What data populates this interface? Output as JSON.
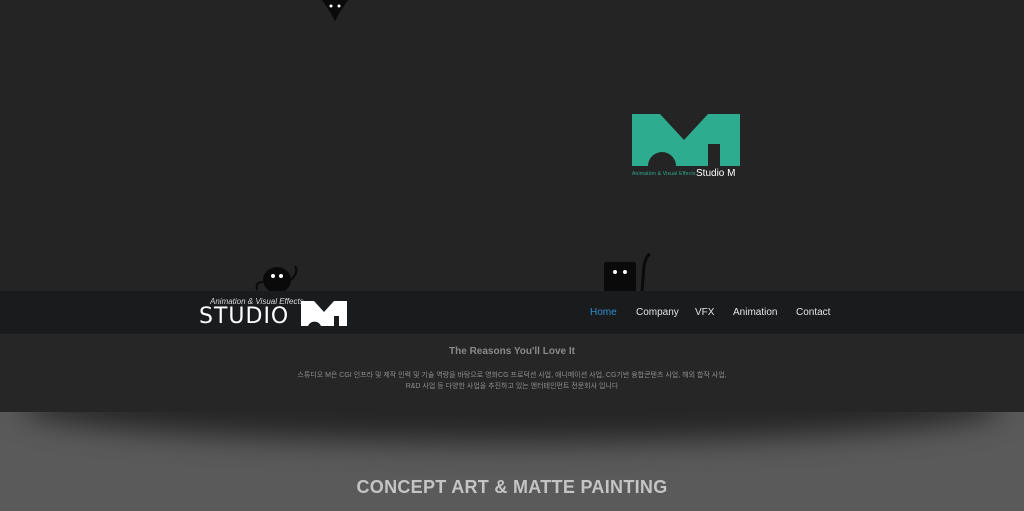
{
  "hero": {
    "logo": {
      "tagline": "Animation & Visual Effects",
      "name": "Studio M",
      "color": "#2eac8f"
    }
  },
  "nav": {
    "logo_tagline": "Animation & Visual Effects",
    "logo_text": "STUDIO",
    "items": [
      {
        "label": "Home",
        "active": true
      },
      {
        "label": "Company",
        "active": false
      },
      {
        "label": "VFX",
        "active": false
      },
      {
        "label": "Animation",
        "active": false
      },
      {
        "label": "Contact",
        "active": false
      }
    ],
    "active_color": "#2f8fd0"
  },
  "reasons": {
    "title": "The Reasons You'll Love It",
    "line1": "스튜디오 M은 CGI 인프라 및 제작 인력 및 기술 역량을 바탕으로 영화CG 프로덕션 사업, 애니메이션 사업, CG기반 융합콘텐츠 사업, 해외 합작 사업,",
    "line2": "R&D 사업 등 다양한 사업을 추진하고 있는 엔터테인먼트 전문회사 입니다"
  },
  "section": {
    "title": "CONCEPT ART & MATTE PAINTING"
  }
}
